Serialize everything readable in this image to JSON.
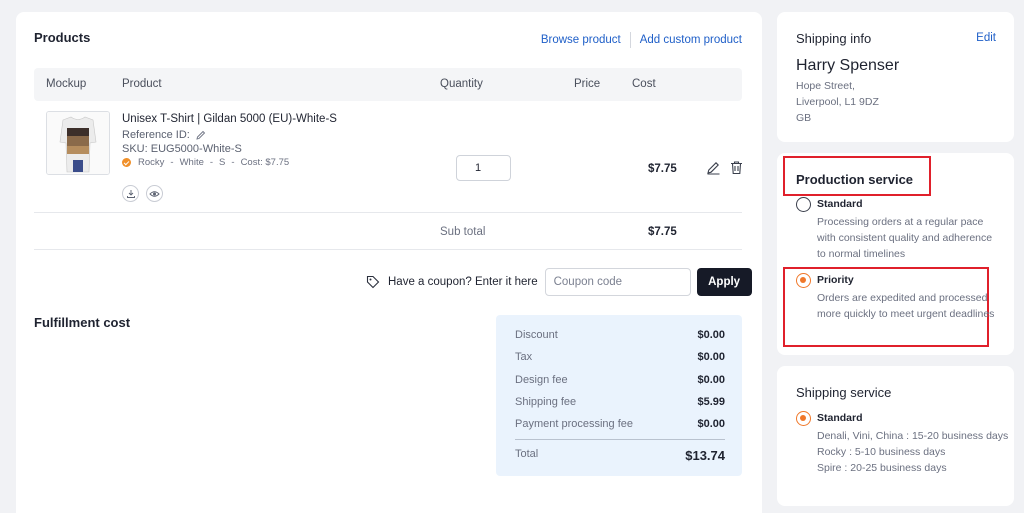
{
  "products": {
    "title": "Products",
    "browse_label": "Browse product",
    "custom_label": "Add custom product",
    "columns": {
      "mockup": "Mockup",
      "product": "Product",
      "quantity": "Quantity",
      "price": "Price",
      "cost": "Cost"
    },
    "item": {
      "name": "Unisex T-Shirt | Gildan 5000 (EU)-White-S",
      "reference": "Reference ID:",
      "sku": "SKU: EUG5000-White-S",
      "provider": "Rocky",
      "color": "White",
      "size": "S",
      "variant_cost": "Cost: $7.75",
      "quantity": "1",
      "cost": "$7.75"
    },
    "subtotal_label": "Sub total",
    "subtotal_value": "$7.75"
  },
  "coupon": {
    "prompt": "Have a coupon? Enter it here",
    "placeholder": "Coupon code",
    "apply_label": "Apply"
  },
  "fulfillment": {
    "title": "Fulfillment cost",
    "rows": [
      {
        "label": "Discount",
        "value": "$0.00"
      },
      {
        "label": "Tax",
        "value": "$0.00"
      },
      {
        "label": "Design fee",
        "value": "$0.00"
      },
      {
        "label": "Shipping fee",
        "value": "$5.99"
      },
      {
        "label": "Payment processing fee",
        "value": "$0.00"
      }
    ],
    "total_label": "Total",
    "total_value": "$13.74"
  },
  "shipping_info": {
    "title": "Shipping info",
    "edit_label": "Edit",
    "name": "Harry Spenser",
    "address": [
      "Hope Street,",
      "Liverpool, L1 9DZ",
      "GB"
    ]
  },
  "production_service": {
    "title": "Production service",
    "options": [
      {
        "label": "Standard",
        "desc": "Processing orders at a regular pace with consistent quality and adherence to normal timelines",
        "selected": false
      },
      {
        "label": "Priority",
        "desc": "Orders are expedited and processed more quickly to meet urgent deadlines",
        "selected": true
      }
    ]
  },
  "shipping_service": {
    "title": "Shipping service",
    "option_label": "Standard",
    "lines": [
      "Denali, Vini, China : 15-20 business days",
      "Rocky : 5-10 business days",
      "Spire : 20-25 business days"
    ]
  },
  "colors": {
    "accent": "#f0782a",
    "link": "#1f5fc8",
    "highlight": "#e0202b",
    "cost_bg": "#eaf3fd"
  }
}
